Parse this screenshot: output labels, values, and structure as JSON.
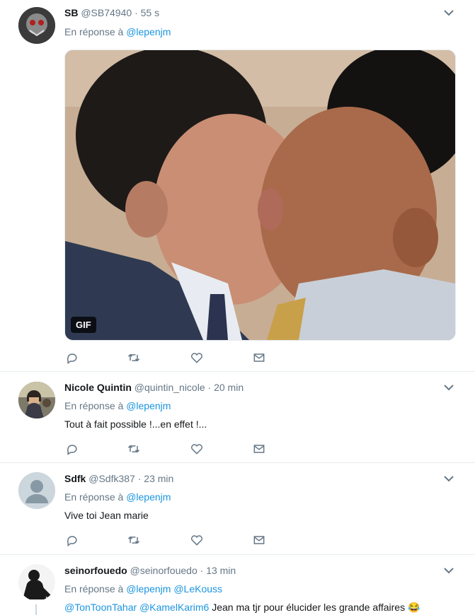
{
  "tweets": [
    {
      "name": "SB",
      "handle": "@SB74940",
      "sep": "·",
      "time": "55 s",
      "reply_prefix": "En réponse à",
      "reply_to": "@lepenjm",
      "media_badge": "GIF"
    },
    {
      "name": "Nicole Quintin",
      "handle": "@quintin_nicole",
      "sep": "·",
      "time": "20 min",
      "reply_prefix": "En réponse à",
      "reply_to": "@lepenjm",
      "text": "Tout à fait possible !...en effet !..."
    },
    {
      "name": "Sdfk",
      "handle": "@Sdfk387",
      "sep": "·",
      "time": "23 min",
      "reply_prefix": "En réponse à",
      "reply_to": "@lepenjm",
      "text": "Vive toi Jean marie"
    },
    {
      "name": "seinorfouedo",
      "handle": "@seinorfouedo",
      "sep": "·",
      "time": "13 min",
      "reply_prefix": "En réponse à",
      "reply_to": "@lepenjm",
      "reply_to_2": "@LeKouss",
      "mention_1": "@TonToonTahar",
      "mention_2": "@KamelKarim6",
      "text": "Jean ma tjr pour élucider les grande affaires",
      "emoji": "😂"
    }
  ],
  "icons": {
    "reply": "reply-icon",
    "retweet": "retweet-icon",
    "like": "heart-icon",
    "message": "envelope-icon",
    "caret": "chevron-down-icon"
  },
  "colors": {
    "link": "#1b95e0",
    "secondary_text": "#657786",
    "divider": "#e6ecf0"
  }
}
